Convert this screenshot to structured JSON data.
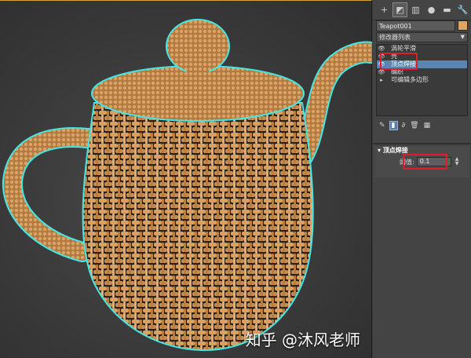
{
  "panel": {
    "tabs": [
      {
        "name": "create-tab",
        "glyph": "+"
      },
      {
        "name": "modify-tab",
        "glyph": "◩"
      },
      {
        "name": "hierarchy-tab",
        "glyph": "▥"
      },
      {
        "name": "motion-tab",
        "glyph": "●"
      },
      {
        "name": "display-tab",
        "glyph": "▬"
      },
      {
        "name": "utilities-tab",
        "glyph": "🔧"
      }
    ],
    "object_name": "Teapot001",
    "object_color": "#e0a462",
    "modifier_list": "修改器列表",
    "stack": [
      {
        "label": "涡轮平滑",
        "eye": "👁",
        "selected": false
      },
      {
        "label": "壳",
        "eye": "👁",
        "selected": false
      },
      {
        "label": "顶点焊接",
        "eye": "👁",
        "selected": true
      },
      {
        "label": "编织",
        "eye": "👁",
        "selected": false
      },
      {
        "label": "可编辑多边形",
        "eye": "▸",
        "selected": false
      }
    ],
    "tools": [
      "pin-icon",
      "show-end-result-icon",
      "make-unique-icon",
      "remove-modifier-icon",
      "configure-icon"
    ],
    "rollout": {
      "title": "顶点焊接",
      "param_label": "阈值:",
      "param_value": "0.1"
    }
  },
  "watermark": "知乎 @沐风老师",
  "colors": {
    "accent_red": "#e11d2a",
    "selection_blue": "#5b84b1",
    "weave_tan": "#d49a5c",
    "outline_cyan": "#45e6e6"
  }
}
